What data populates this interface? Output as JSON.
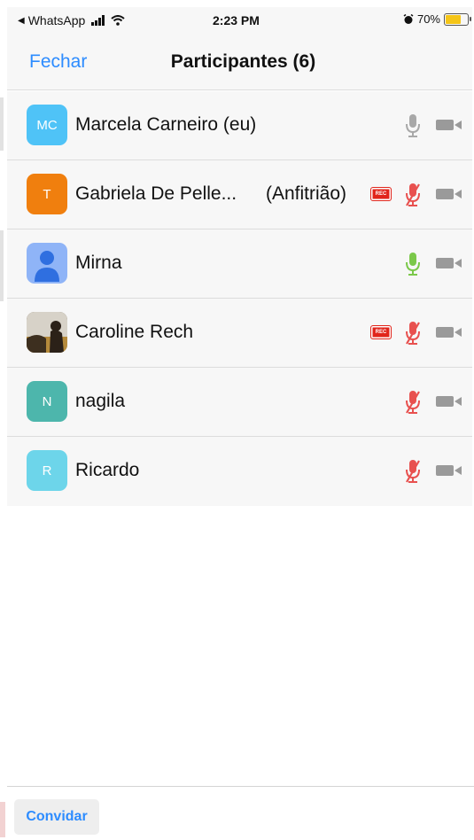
{
  "status_bar": {
    "back_app": "WhatsApp",
    "time": "2:23 PM",
    "battery_text": "70%",
    "battery_level": 0.7,
    "icons": [
      "signal-icon",
      "wifi-icon",
      "alarm-icon",
      "battery-icon"
    ]
  },
  "nav": {
    "close_label": "Fechar",
    "title": "Participantes (6)"
  },
  "participants": [
    {
      "initials": "MC",
      "name": "Marcela Carneiro (eu)",
      "role": "",
      "avatar_color": "#4fc3f7",
      "recording": false,
      "mic": "on-grey",
      "camera": "off"
    },
    {
      "initials": "T",
      "name": "Gabriela De Pelle...",
      "role": "(Anfitrião)",
      "avatar_color": "#f07f0e",
      "recording": true,
      "rec_label": "REC",
      "mic": "muted",
      "camera": "off"
    },
    {
      "initials": "",
      "name": "Mirna",
      "role": "",
      "avatar_color": "#8fb4f7",
      "avatar_icon": "person-icon",
      "recording": false,
      "mic": "on-green",
      "camera": "off"
    },
    {
      "initials": "",
      "name": "Caroline Rech",
      "role": "",
      "avatar_color": "#5a4a32",
      "avatar_icon": "photo-avatar",
      "recording": true,
      "rec_label": "REC",
      "mic": "muted",
      "camera": "off"
    },
    {
      "initials": "N",
      "name": "nagila",
      "role": "",
      "avatar_color": "#4db6ac",
      "recording": false,
      "mic": "muted",
      "camera": "off"
    },
    {
      "initials": "R",
      "name": "Ricardo",
      "role": "",
      "avatar_color": "#6dd5ea",
      "recording": false,
      "mic": "muted",
      "camera": "off"
    }
  ],
  "footer": {
    "invite_label": "Convidar"
  },
  "colors": {
    "accent": "#2d8cff",
    "muted_mic": "#e8514f",
    "active_mic": "#7bc84a",
    "rec": "#e1251b"
  }
}
